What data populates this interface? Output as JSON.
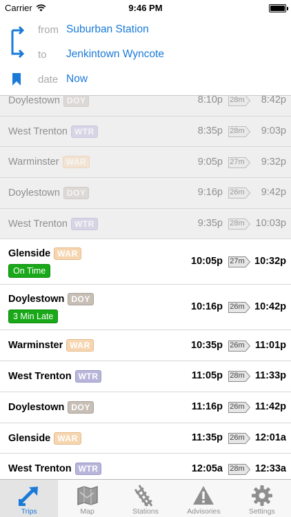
{
  "status_bar": {
    "carrier": "Carrier",
    "time": "9:46 PM"
  },
  "trip": {
    "from_label": "from",
    "from_value": "Suburban Station",
    "to_label": "to",
    "to_value": "Jenkintown Wyncote",
    "date_label": "date",
    "date_value": "Now"
  },
  "trains": [
    {
      "name": "Doylestown",
      "code": "DOY",
      "depart": "8:10p",
      "duration": "28m",
      "arrive": "8:42p",
      "past": true,
      "status": ""
    },
    {
      "name": "West Trenton",
      "code": "WTR",
      "depart": "8:35p",
      "duration": "28m",
      "arrive": "9:03p",
      "past": true,
      "status": ""
    },
    {
      "name": "Warminster",
      "code": "WAR",
      "depart": "9:05p",
      "duration": "27m",
      "arrive": "9:32p",
      "past": true,
      "status": ""
    },
    {
      "name": "Doylestown",
      "code": "DOY",
      "depart": "9:16p",
      "duration": "26m",
      "arrive": "9:42p",
      "past": true,
      "status": ""
    },
    {
      "name": "West Trenton",
      "code": "WTR",
      "depart": "9:35p",
      "duration": "28m",
      "arrive": "10:03p",
      "past": true,
      "status": ""
    },
    {
      "name": "Glenside",
      "code": "WAR",
      "depart": "10:05p",
      "duration": "27m",
      "arrive": "10:32p",
      "past": false,
      "status": "On Time"
    },
    {
      "name": "Doylestown",
      "code": "DOY",
      "depart": "10:16p",
      "duration": "26m",
      "arrive": "10:42p",
      "past": false,
      "status": "3 Min Late"
    },
    {
      "name": "Warminster",
      "code": "WAR",
      "depart": "10:35p",
      "duration": "26m",
      "arrive": "11:01p",
      "past": false,
      "status": ""
    },
    {
      "name": "West Trenton",
      "code": "WTR",
      "depart": "11:05p",
      "duration": "28m",
      "arrive": "11:33p",
      "past": false,
      "status": ""
    },
    {
      "name": "Doylestown",
      "code": "DOY",
      "depart": "11:16p",
      "duration": "26m",
      "arrive": "11:42p",
      "past": false,
      "status": ""
    },
    {
      "name": "Glenside",
      "code": "WAR",
      "depart": "11:35p",
      "duration": "26m",
      "arrive": "12:01a",
      "past": false,
      "status": ""
    },
    {
      "name": "West Trenton",
      "code": "WTR",
      "depart": "12:05a",
      "duration": "28m",
      "arrive": "12:33a",
      "past": false,
      "status": ""
    }
  ],
  "tabs": [
    {
      "label": "Trips",
      "icon": "trips-arrows-icon",
      "active": true
    },
    {
      "label": "Map",
      "icon": "map-icon",
      "active": false
    },
    {
      "label": "Stations",
      "icon": "railroad-track-icon",
      "active": false
    },
    {
      "label": "Advisories",
      "icon": "warning-icon",
      "active": false
    },
    {
      "label": "Settings",
      "icon": "gear-icon",
      "active": false
    }
  ],
  "colors": {
    "accent": "#1a7ad8",
    "on_time": "#18a818",
    "line_WTR": "#b8b5da",
    "line_DOY": "#c7beb6",
    "line_WAR": "#f6d6b0"
  }
}
